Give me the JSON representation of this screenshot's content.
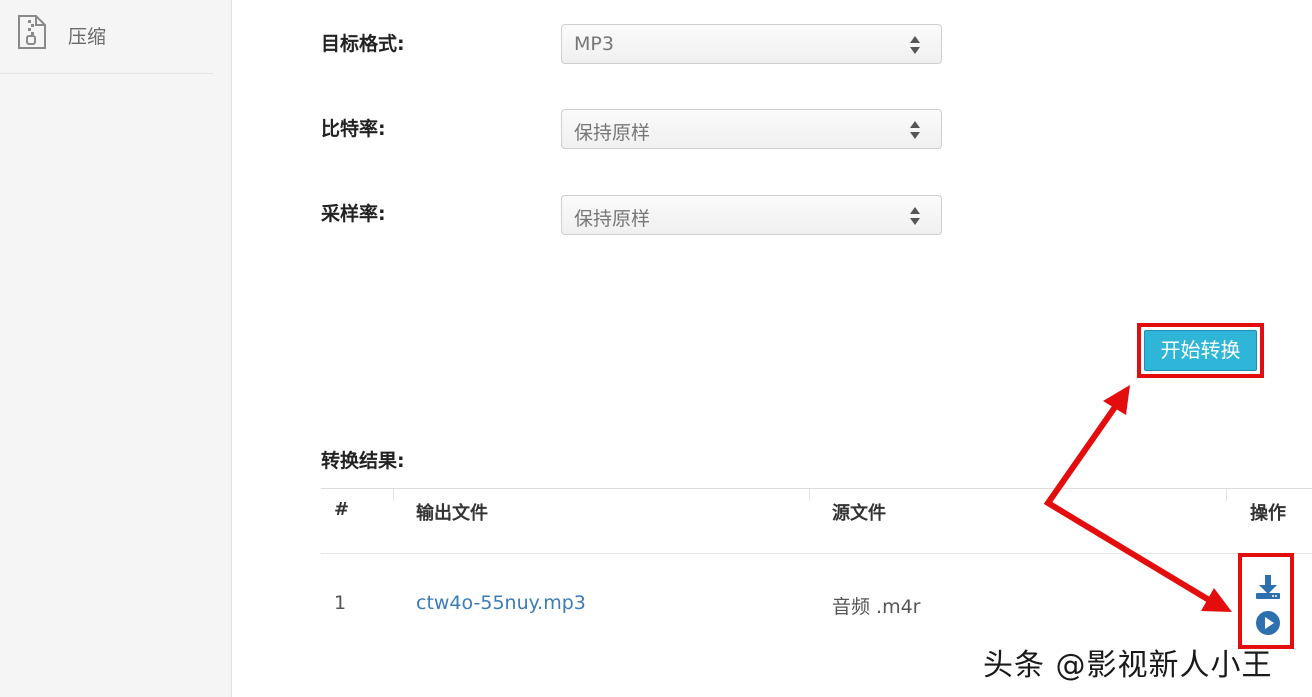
{
  "sidebar": {
    "items": [
      {
        "label": "压缩",
        "icon": "zip-file-icon"
      }
    ]
  },
  "form": {
    "target_format": {
      "label": "目标格式:",
      "value": "MP3"
    },
    "bitrate": {
      "label": "比特率:",
      "value": "保持原样"
    },
    "sample_rate": {
      "label": "采样率:",
      "value": "保持原样"
    }
  },
  "convert_button": {
    "label": "开始转换",
    "color": "#2fb5d8"
  },
  "results": {
    "title": "转换结果:",
    "columns": [
      "#",
      "输出文件",
      "源文件",
      "操作"
    ],
    "rows": [
      {
        "index": "1",
        "output_file": "ctw4o-55nuy.mp3",
        "source_file": "音频 .m4r",
        "actions": [
          "download-icon",
          "play-icon"
        ]
      }
    ]
  },
  "annotation": {
    "highlight_color": "#e30d0d"
  },
  "watermark": "头条 @影视新人小王"
}
